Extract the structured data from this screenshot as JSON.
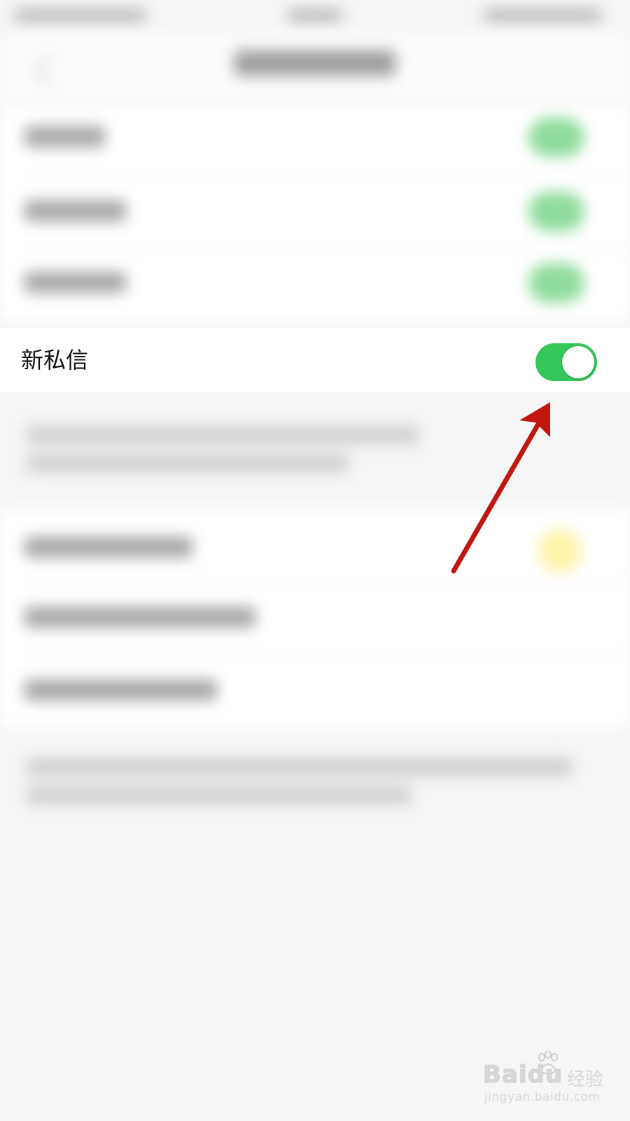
{
  "focus_row": {
    "label": "新私信",
    "toggle_on": true
  },
  "colors": {
    "toggle_on": "#34c759",
    "arrow": "#c0160f",
    "background": "#f6f6f6"
  },
  "watermark": {
    "brand": "Baidu",
    "suffix": "经验",
    "url": "jingyan.baidu.com"
  }
}
